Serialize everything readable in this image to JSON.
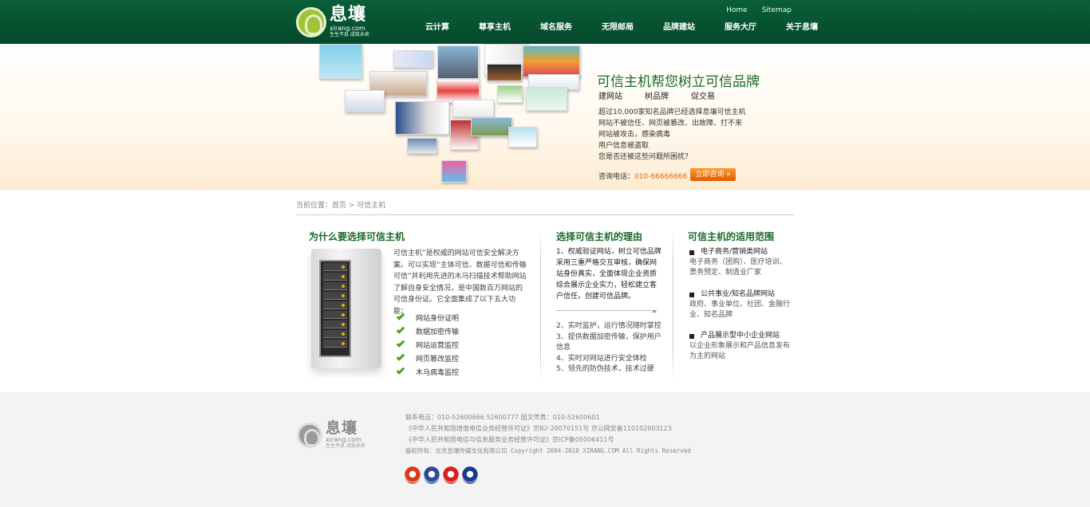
{
  "header": {
    "logo_cn": "息壤",
    "logo_url": "xirang.com",
    "logo_slogan": "生生不息 成就未来",
    "toplinks": [
      "Home",
      "Sitemap"
    ],
    "nav": [
      "云计算",
      "尊享主机",
      "域名服务",
      "无限邮局",
      "品牌建站",
      "服务大厅",
      "关于息壤"
    ]
  },
  "banner": {
    "title": "可信主机帮您树立可信品牌",
    "tags": [
      "建网站",
      "树品牌",
      "促交易"
    ],
    "lines": [
      "超过10,000家知名品牌已经选择息壤可信主机",
      "网站不被信任、网页被篡改、出故障、打不来",
      "网站被攻击，感染病毒",
      "用户信息被盗取",
      "您是否还被这些问题所困扰？"
    ],
    "consult_label": "咨询电话：",
    "consult_phone": "010-66666666",
    "consult_button": "立即咨询 »"
  },
  "breadcrumb": "当前位置：首页 > 可信主机",
  "col1": {
    "title": "为什么要选择可信主机",
    "text": "可信主机”是权威的网站可信安全解决方案。可以实现“主体可信、数据可信和传输可信”并利用先进的木马扫描技术帮助网站了解自身安全情况，是中国数百万网站的可信身份证。它全面集成了以下五大功能：",
    "features": [
      "网站身份证明",
      "数据加密传输",
      "网站运营监控",
      "网页篡改监控",
      "木马病毒监控"
    ]
  },
  "col2": {
    "title": "选择可信主机的理由",
    "top": "1、权威验证网站，树立可信品牌采用三重严格交互审核，确保网站身份真实，全面体现企业资质综合展示企业实力，轻松建立客户信任，创建可信品牌。",
    "items": [
      "2、实时监护，运行情况随时掌控",
      "3、提供数据加密传输，保护用户信息",
      "4、实时对网站进行安全体检",
      "5、领先的防伪技术，技术过硬"
    ]
  },
  "col3": {
    "title": "可信主机的适用范围",
    "scopes": [
      {
        "head": "电子商务/营销类网站",
        "desc": "电子商务（团购）、医疗培训、票务预定、制造业厂家"
      },
      {
        "head": "公共事业/知名品牌网站",
        "desc": "政府、事业单位、社团、金融行业、知名品牌"
      },
      {
        "head": "产品展示型中小企业网站",
        "desc": "以企业形象展示和产品信息发布为主的网站"
      }
    ]
  },
  "footer": {
    "phone_line": "联系电话：010-52600666  52600777      图文传真：010-52600601",
    "lic1": "《中华人民共和国增值电信业务经营许可证》京B2-20070151号   京公网安备110102003123",
    "lic2": "《中华人民共和国电信与信息服务业务经营许可证》京ICP备05006411号",
    "copyright": "版权所有：北京息壤传媒文化有限公司 Copyright 2004-2010 XIRANG.COM All Rights Reserved",
    "badge_colors": [
      "#d83a1a",
      "#2a4a9a",
      "#d82020",
      "#1a3a8a"
    ]
  }
}
